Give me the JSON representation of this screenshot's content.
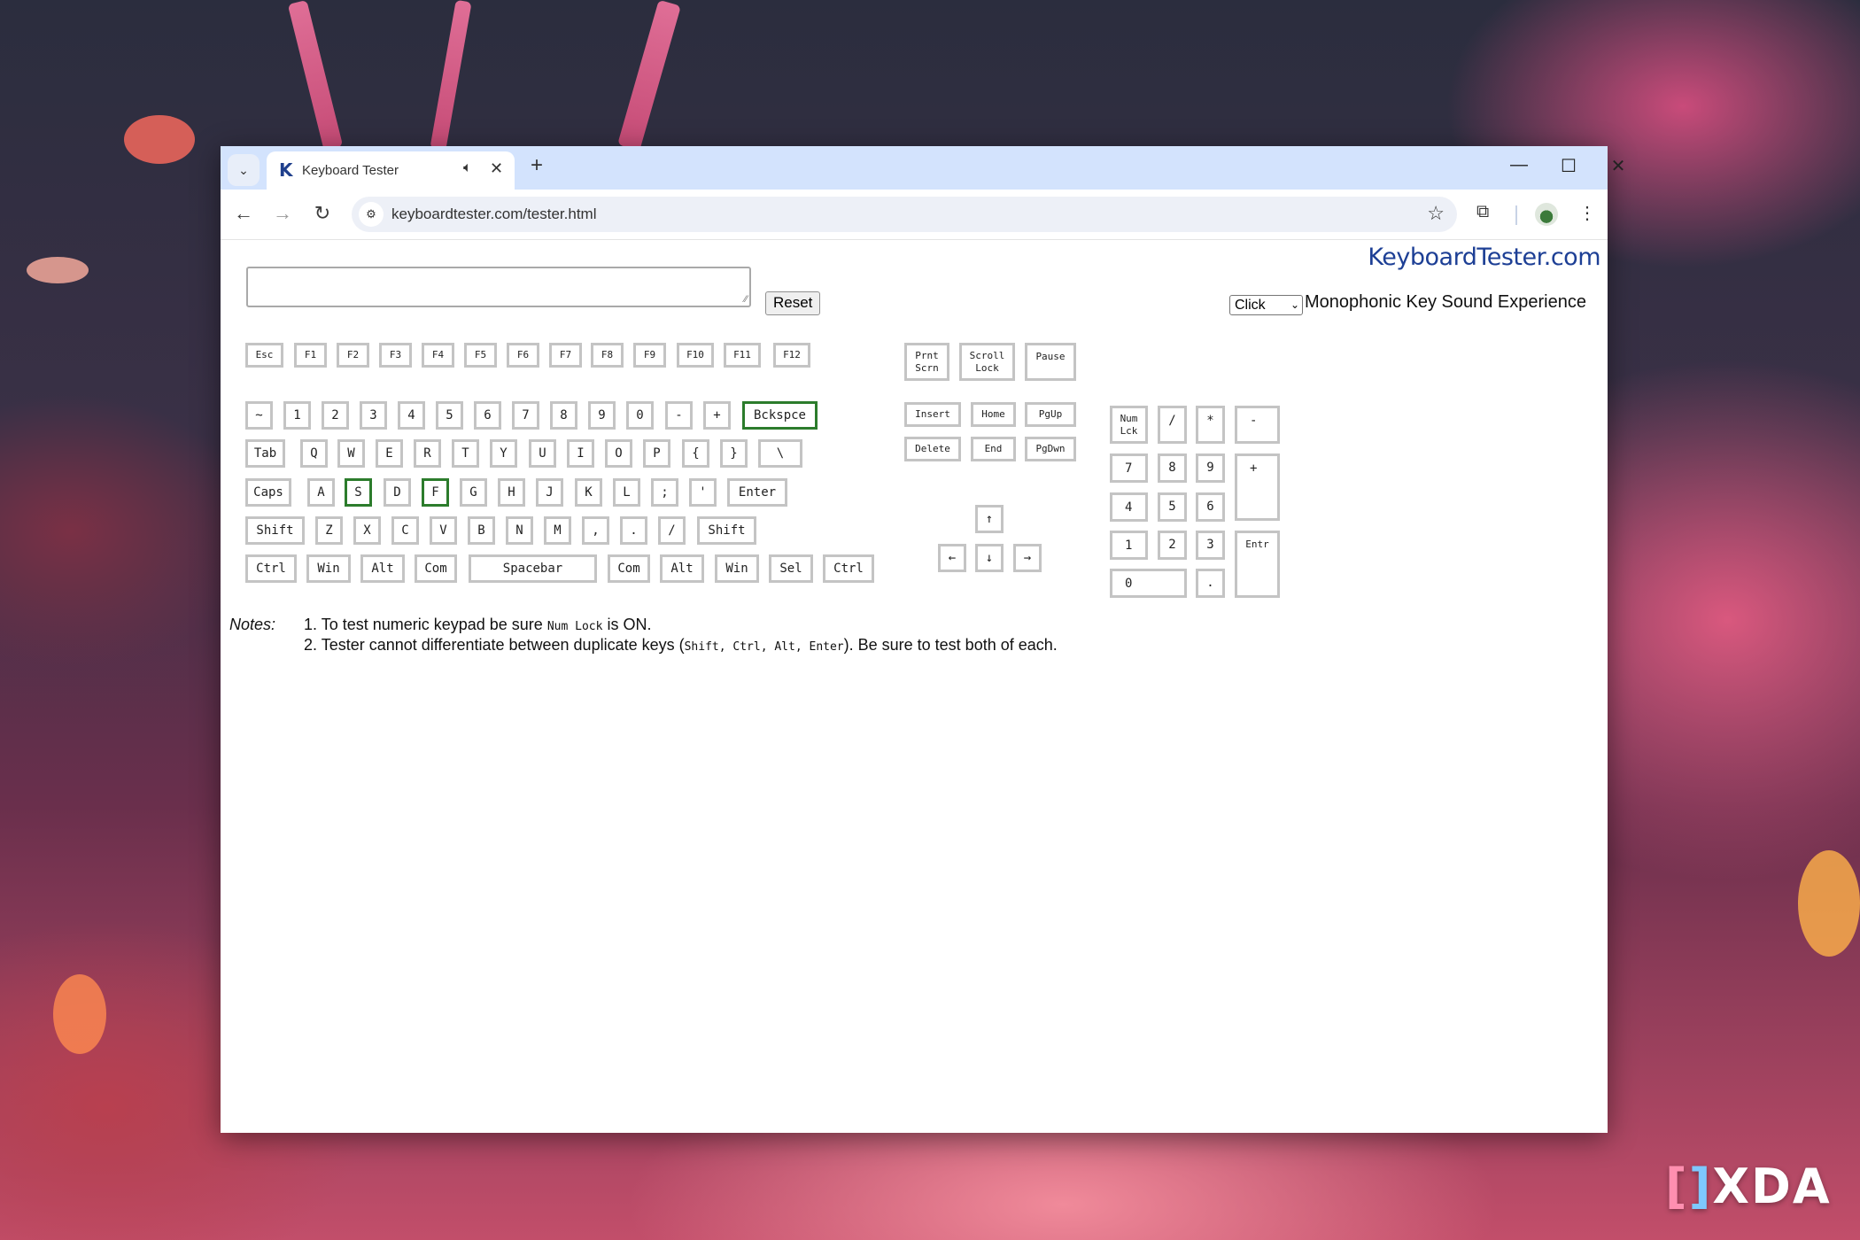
{
  "browser": {
    "tab": {
      "favicon": "K",
      "title": "Keyboard Tester",
      "audio_icon": "speaker-icon",
      "close": "✕"
    },
    "new_tab": "+",
    "window_controls": {
      "minimize": "—",
      "maximize": "☐",
      "close": "✕"
    },
    "nav": {
      "back": "←",
      "forward": "→",
      "reload": "↻"
    },
    "url": "keyboardtester.com/tester.html",
    "site_info_icon": "⚙",
    "bookmark_icon": "☆",
    "extensions_icon": "⧉",
    "menu_icon": "⋮",
    "tab_search_icon": "⌄"
  },
  "page": {
    "brand": "KeyboardTester.com",
    "reset_label": "Reset",
    "textarea_value": "",
    "sound_select": {
      "selected": "Click",
      "label": "Monophonic Key Sound Experience"
    },
    "pressed_color": "#2c7c2c",
    "keys": {
      "frow": [
        "Esc",
        "F1",
        "F2",
        "F3",
        "F4",
        "F5",
        "F6",
        "F7",
        "F8",
        "F9",
        "F10",
        "F11",
        "F12"
      ],
      "numrow": [
        "~",
        "1",
        "2",
        "3",
        "4",
        "5",
        "6",
        "7",
        "8",
        "9",
        "0",
        "-",
        "+",
        "Bckspce"
      ],
      "qrow": [
        "Tab",
        "Q",
        "W",
        "E",
        "R",
        "T",
        "Y",
        "U",
        "I",
        "O",
        "P",
        "{",
        "}",
        "\\"
      ],
      "arow": [
        "Caps",
        "A",
        "S",
        "D",
        "F",
        "G",
        "H",
        "J",
        "K",
        "L",
        ";",
        "'",
        "Enter"
      ],
      "zrow": [
        "Shift",
        "Z",
        "X",
        "C",
        "V",
        "B",
        "N",
        "M",
        ",",
        ".",
        "/",
        "Shift"
      ],
      "bottom": [
        "Ctrl",
        "Win",
        "Alt",
        "Com",
        "Spacebar",
        "Com",
        "Alt",
        "Win",
        "Sel",
        "Ctrl"
      ],
      "sys": [
        "Prnt\nScrn",
        "Scroll\nLock",
        "Pause"
      ],
      "nav": [
        "Insert",
        "Home",
        "PgUp",
        "Delete",
        "End",
        "PgDwn"
      ],
      "arrows": [
        "↑",
        "←",
        "↓",
        "→"
      ],
      "numpad": [
        "Num\nLck",
        "/",
        "*",
        "-",
        "7",
        "8",
        "9",
        "+",
        "4",
        "5",
        "6",
        "1",
        "2",
        "3",
        "Entr",
        "0",
        "."
      ]
    },
    "pressed_keys": [
      "Bckspce",
      "S",
      "F"
    ],
    "notes": {
      "label": "Notes:",
      "items": [
        {
          "pre": "1. To test numeric keypad be sure ",
          "code": "Num Lock",
          "post": " is ON."
        },
        {
          "pre": "2. Tester cannot differentiate between duplicate keys (",
          "code": "Shift, Ctrl, Alt, Enter",
          "post": "). Be sure to test both of each."
        }
      ]
    }
  },
  "watermark": {
    "text": "XDA"
  }
}
